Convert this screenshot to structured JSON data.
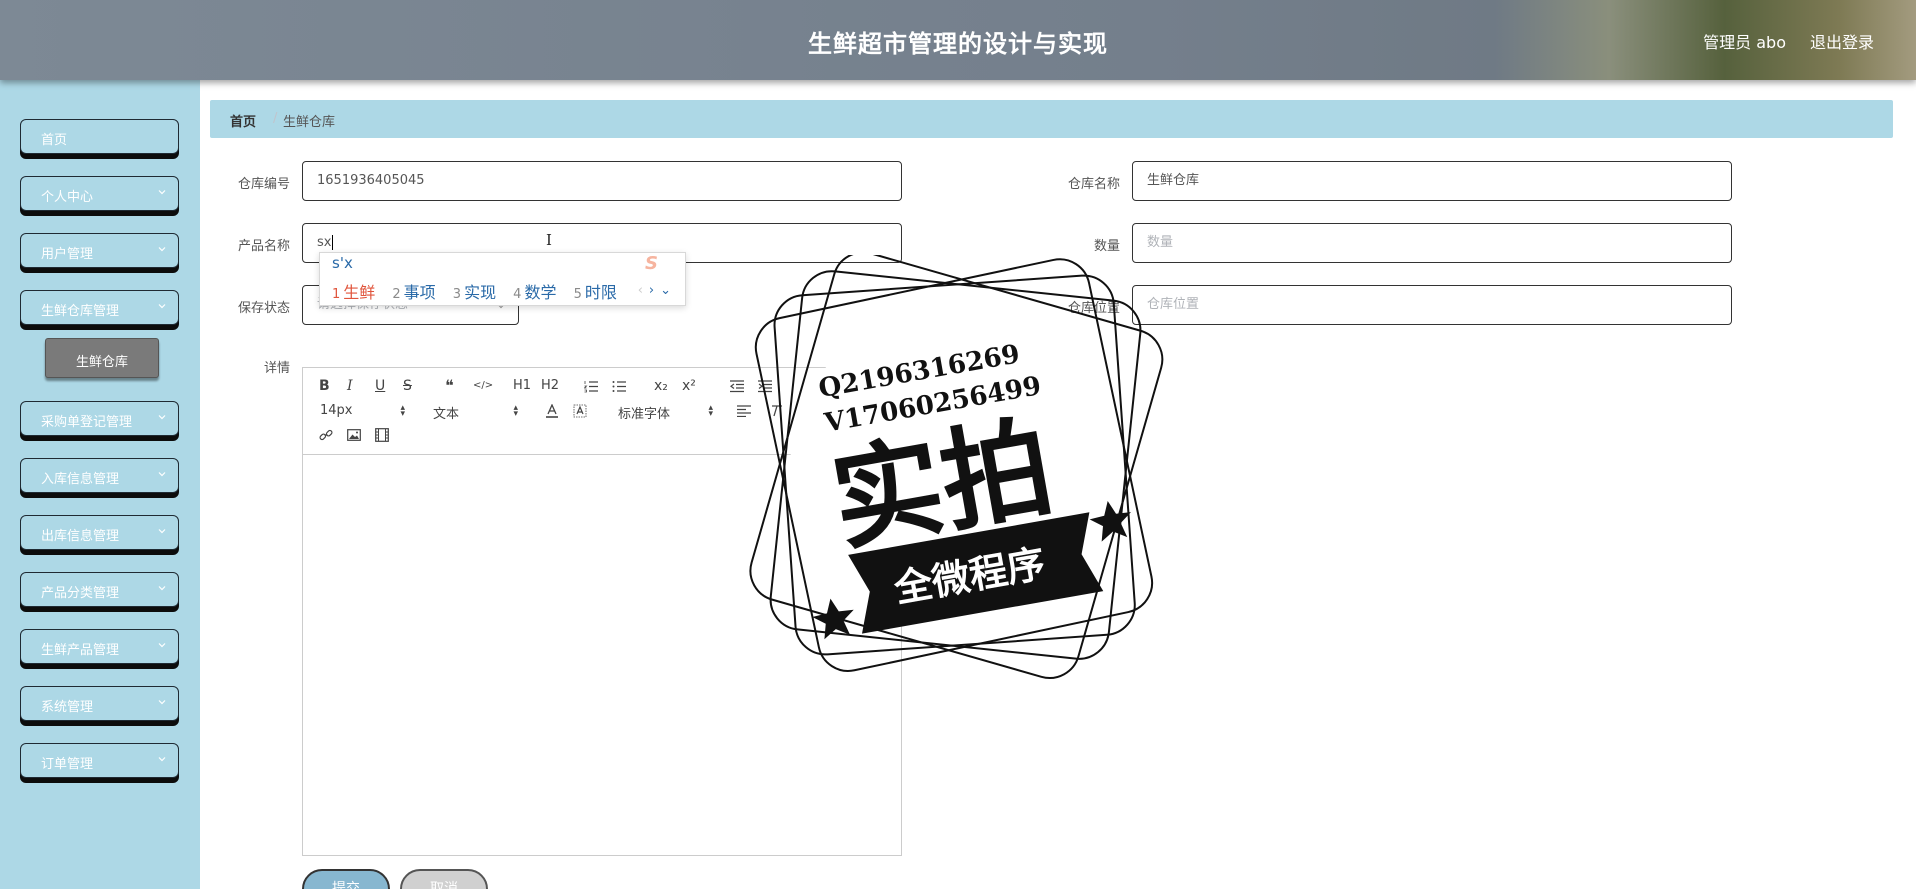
{
  "header": {
    "title": "生鲜超市管理的设计与实现",
    "user": "管理员 abo",
    "logout": "退出登录"
  },
  "sidebar": {
    "items": [
      {
        "label": "首页",
        "has_children": false
      },
      {
        "label": "个人中心",
        "has_children": true
      },
      {
        "label": "用户管理",
        "has_children": true
      },
      {
        "label": "生鲜仓库管理",
        "has_children": true
      },
      {
        "label": "采购单登记管理",
        "has_children": true
      },
      {
        "label": "入库信息管理",
        "has_children": true
      },
      {
        "label": "出库信息管理",
        "has_children": true
      },
      {
        "label": "产品分类管理",
        "has_children": true
      },
      {
        "label": "生鲜产品管理",
        "has_children": true
      },
      {
        "label": "系统管理",
        "has_children": true
      },
      {
        "label": "订单管理",
        "has_children": true
      }
    ],
    "subitem": {
      "label": "生鲜仓库"
    }
  },
  "breadcrumb": {
    "home": "首页",
    "separator": "/",
    "current": "生鲜仓库"
  },
  "form": {
    "warehouse_no": {
      "label": "仓库编号",
      "value": "1651936405045"
    },
    "warehouse_name": {
      "label": "仓库名称",
      "value": "生鲜仓库"
    },
    "product_name": {
      "label": "产品名称",
      "value": "sx"
    },
    "quantity": {
      "label": "数量",
      "placeholder": "数量"
    },
    "storage_status": {
      "label": "保存状态",
      "placeholder": "请选择保存状态"
    },
    "location": {
      "label": "仓库位置",
      "placeholder": "仓库位置"
    },
    "details": {
      "label": "详情"
    }
  },
  "editor": {
    "toolbar_row1": [
      "B",
      "I",
      "U",
      "S",
      "❝",
      "</>",
      "H1",
      "H2",
      "ordered-list",
      "bullet-list",
      "x₂",
      "x²",
      "outdent",
      "indent"
    ],
    "font_size": "14px",
    "header_select": "文本",
    "font_family": "标准字体"
  },
  "ime": {
    "pinyin": "s'x",
    "candidates": [
      {
        "num": "1",
        "text": "生鲜"
      },
      {
        "num": "2",
        "text": "事项"
      },
      {
        "num": "3",
        "text": "实现"
      },
      {
        "num": "4",
        "text": "数学"
      },
      {
        "num": "5",
        "text": "时限"
      }
    ]
  },
  "buttons": {
    "submit": "提交",
    "cancel": "取消"
  },
  "watermark": {
    "line1": "Q2196316269",
    "line2": "V17060256499",
    "big": "实拍",
    "banner": "全微程序"
  },
  "colors": {
    "sidebar_bg": "#add8e6",
    "breadcrumb_bg": "#add8e6",
    "header_bg": "#777f8a",
    "submit_bg": "#87b7d0"
  }
}
